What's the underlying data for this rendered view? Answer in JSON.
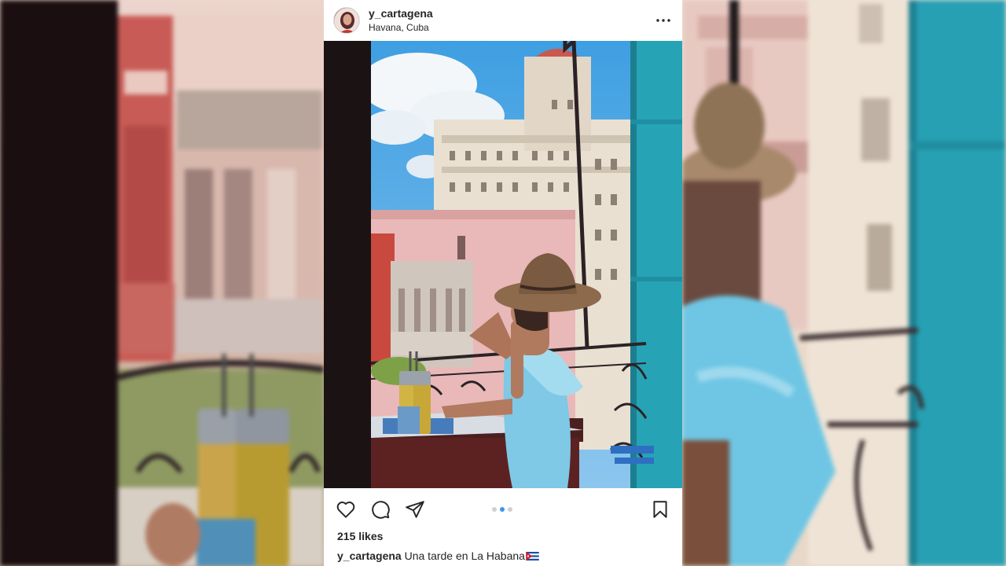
{
  "post": {
    "username": "y_cartagena",
    "location": "Havana, Cuba",
    "more_icon": "more-horizontal-icon",
    "likes": "215 likes",
    "caption_user": "y_cartagena",
    "caption_text": "Una tarde en La Habana",
    "caption_emoji": "cuba-flag",
    "carousel": {
      "count": 3,
      "active_index": 1
    },
    "actions": [
      "heart-icon",
      "comment-icon",
      "share-icon",
      "bookmark-icon"
    ]
  },
  "colors": {
    "text": "#262626",
    "carousel_active": "#3897f0",
    "carousel_inactive": "#d0d0d0",
    "card_background": "#ffffff"
  }
}
